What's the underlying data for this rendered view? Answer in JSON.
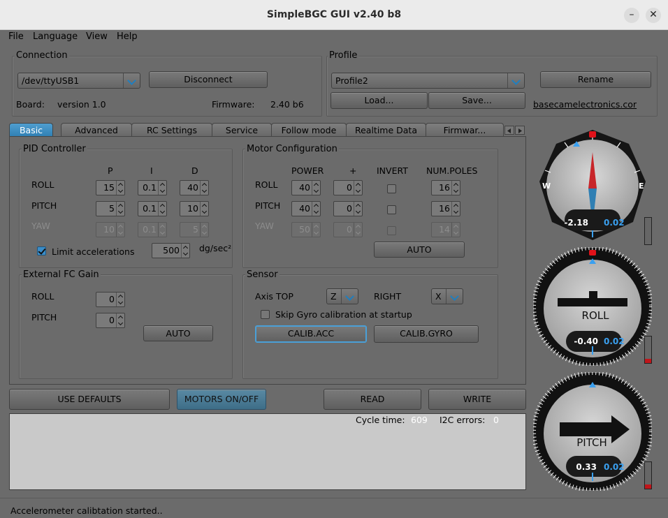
{
  "window": {
    "title": "SimpleBGC GUI v2.40 b8",
    "minimize": "–",
    "close": "✕"
  },
  "menu": [
    "File",
    "Language",
    "View",
    "Help"
  ],
  "connection": {
    "title": "Connection",
    "port": "/dev/ttyUSB1",
    "disconnect": "Disconnect",
    "board_label": "Board:",
    "board_value": "version 1.0",
    "firmware_label": "Firmware:",
    "firmware_value": "2.40 b6"
  },
  "profile": {
    "title": "Profile",
    "selected": "Profile2",
    "load": "Load...",
    "save": "Save...",
    "rename": "Rename",
    "link": "basecamelectronics.cor"
  },
  "tabs": [
    "Basic",
    "Advanced",
    "RC Settings",
    "Service",
    "Follow mode",
    "Realtime Data",
    "Firmwar..."
  ],
  "pid": {
    "title": "PID Controller",
    "headers": [
      "P",
      "I",
      "D"
    ],
    "rows": [
      {
        "label": "ROLL",
        "values": [
          "15",
          "0.1",
          "40"
        ]
      },
      {
        "label": "PITCH",
        "values": [
          "5",
          "0.1",
          "10"
        ]
      },
      {
        "label": "YAW",
        "values": [
          "10",
          "0.1",
          "5"
        ]
      }
    ],
    "limit_label": "Limit accelerations",
    "limit_value": "500",
    "limit_unit": "dg/sec²"
  },
  "motor": {
    "title": "Motor Configuration",
    "headers": [
      "POWER",
      "+",
      "INVERT",
      "NUM.POLES"
    ],
    "rows": [
      {
        "label": "ROLL",
        "power": "40",
        "offset": "0",
        "poles": "16"
      },
      {
        "label": "PITCH",
        "power": "40",
        "offset": "0",
        "poles": "16"
      },
      {
        "label": "YAW",
        "power": "50",
        "offset": "0",
        "poles": "14"
      }
    ],
    "auto": "AUTO"
  },
  "ext_fc": {
    "title": "External FC Gain",
    "rows": [
      {
        "label": "ROLL",
        "value": "0"
      },
      {
        "label": "PITCH",
        "value": "0"
      }
    ],
    "auto": "AUTO"
  },
  "sensor": {
    "title": "Sensor",
    "axis_top_label": "Axis TOP",
    "axis_top_value": "Z",
    "right_label": "RIGHT",
    "right_value": "X",
    "skip_gyro": "Skip Gyro calibration at startup",
    "calib_acc": "CALIB.ACC",
    "calib_gyro": "CALIB.GYRO"
  },
  "bottom_buttons": {
    "defaults": "USE DEFAULTS",
    "motors": "MOTORS ON/OFF",
    "read": "READ",
    "write": "WRITE"
  },
  "log": {
    "cycle_label": "Cycle time:",
    "cycle_value": "609",
    "i2c_label": "I2C errors:",
    "i2c_value": "0"
  },
  "status": "Accelerometer calibtation started..",
  "gauges": {
    "yaw": {
      "value": "-2.18",
      "rate": "0.02",
      "west": "W",
      "east": "E",
      "level": 0.0
    },
    "roll": {
      "value": "-0.40",
      "rate": "0.02",
      "caption": "ROLL",
      "level": 0.15
    },
    "pitch": {
      "value": "0.33",
      "rate": "0.02",
      "caption": "PITCH",
      "level": 0.15
    }
  },
  "colors": {
    "accent": "#2f7fb3",
    "rate": "#3aa0f0",
    "marker": "#e0121a"
  }
}
